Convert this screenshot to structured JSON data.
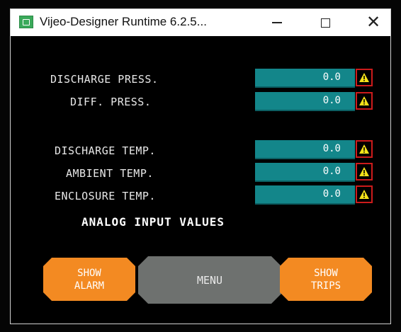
{
  "window": {
    "title": "Vijeo-Designer Runtime 6.2.5...",
    "minimize_icon": "minimize-icon",
    "maximize_icon": "maximize-icon",
    "close_symbol": "✕"
  },
  "analog_inputs": {
    "heading": "ANALOG INPUT VALUES",
    "items": [
      {
        "label": "DISCHARGE PRESS.",
        "value": "0.0"
      },
      {
        "label": "DIFF. PRESS.",
        "value": "0.0"
      },
      {
        "label": "DISCHARGE TEMP.",
        "value": "0.0"
      },
      {
        "label": "AMBIENT TEMP.",
        "value": "0.0"
      },
      {
        "label": "ENCLOSURE TEMP.",
        "value": "0.0"
      }
    ],
    "warning_icon": "warning-triangle-icon",
    "colors": {
      "field_bg": "#13868a",
      "warning_border": "#cc1b1b",
      "warning_fill": "#f5e21a"
    }
  },
  "buttons": {
    "show_alarm": {
      "line1": "SHOW",
      "line2": "ALARM"
    },
    "menu": "MENU",
    "show_trips": {
      "line1": "SHOW",
      "line2": "TRIPS"
    },
    "colors": {
      "orange": "#f38a22",
      "grey": "#6e716f"
    }
  }
}
